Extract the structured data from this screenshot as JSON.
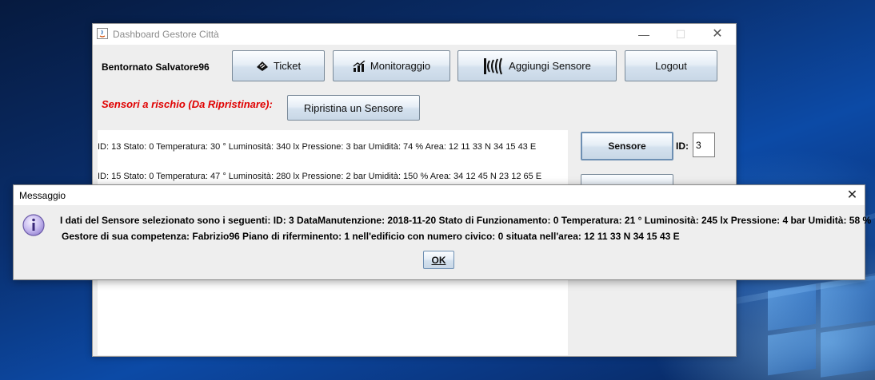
{
  "app": {
    "title": "Dashboard Gestore Città",
    "welcome": "Bentornato Salvatore96",
    "toolbar": {
      "ticket_label": "Ticket",
      "monitor_label": "Monitoraggio",
      "add_sensor_label": "Aggiungi Sensore",
      "logout_label": "Logout"
    },
    "risk_label": "Sensori a rischio (Da Ripristinare):",
    "restore_button": "Ripristina un Sensore",
    "sensor_list": [
      "ID: 13 Stato: 0 Temperatura: 30 ° Luminosità: 340 lx Pressione: 3 bar Umidità: 74 % Area: 12 11 33 N 34 15 43 E",
      "ID: 15 Stato: 0 Temperatura: 47 ° Luminosità: 280 lx Pressione: 2 bar Umidità: 150 % Area: 34 12 45 N 23 12 65 E"
    ],
    "sensor_button": "Sensore",
    "id_label": "ID:",
    "id_value": "3"
  },
  "dialog": {
    "title": "Messaggio",
    "line1": "I dati del Sensore selezionato sono i seguenti: ID: 3 DataManutenzione: 2018-11-20 Stato di Funzionamento: 0 Temperatura: 21 ° Luminosità: 245 lx Pressione: 4 bar Umidità: 58 %",
    "line2": "Gestore di sua competenza: Fabrizio96 Piano di riferminento: 1 nell'edificio con numero civico: 0 situata nell'area: 12 11 33 N 34 15 43 E",
    "ok_label": "OK",
    "icon": "info-icon"
  },
  "colors": {
    "risk_text": "#e00000",
    "desktop": "#0c4aa6"
  }
}
